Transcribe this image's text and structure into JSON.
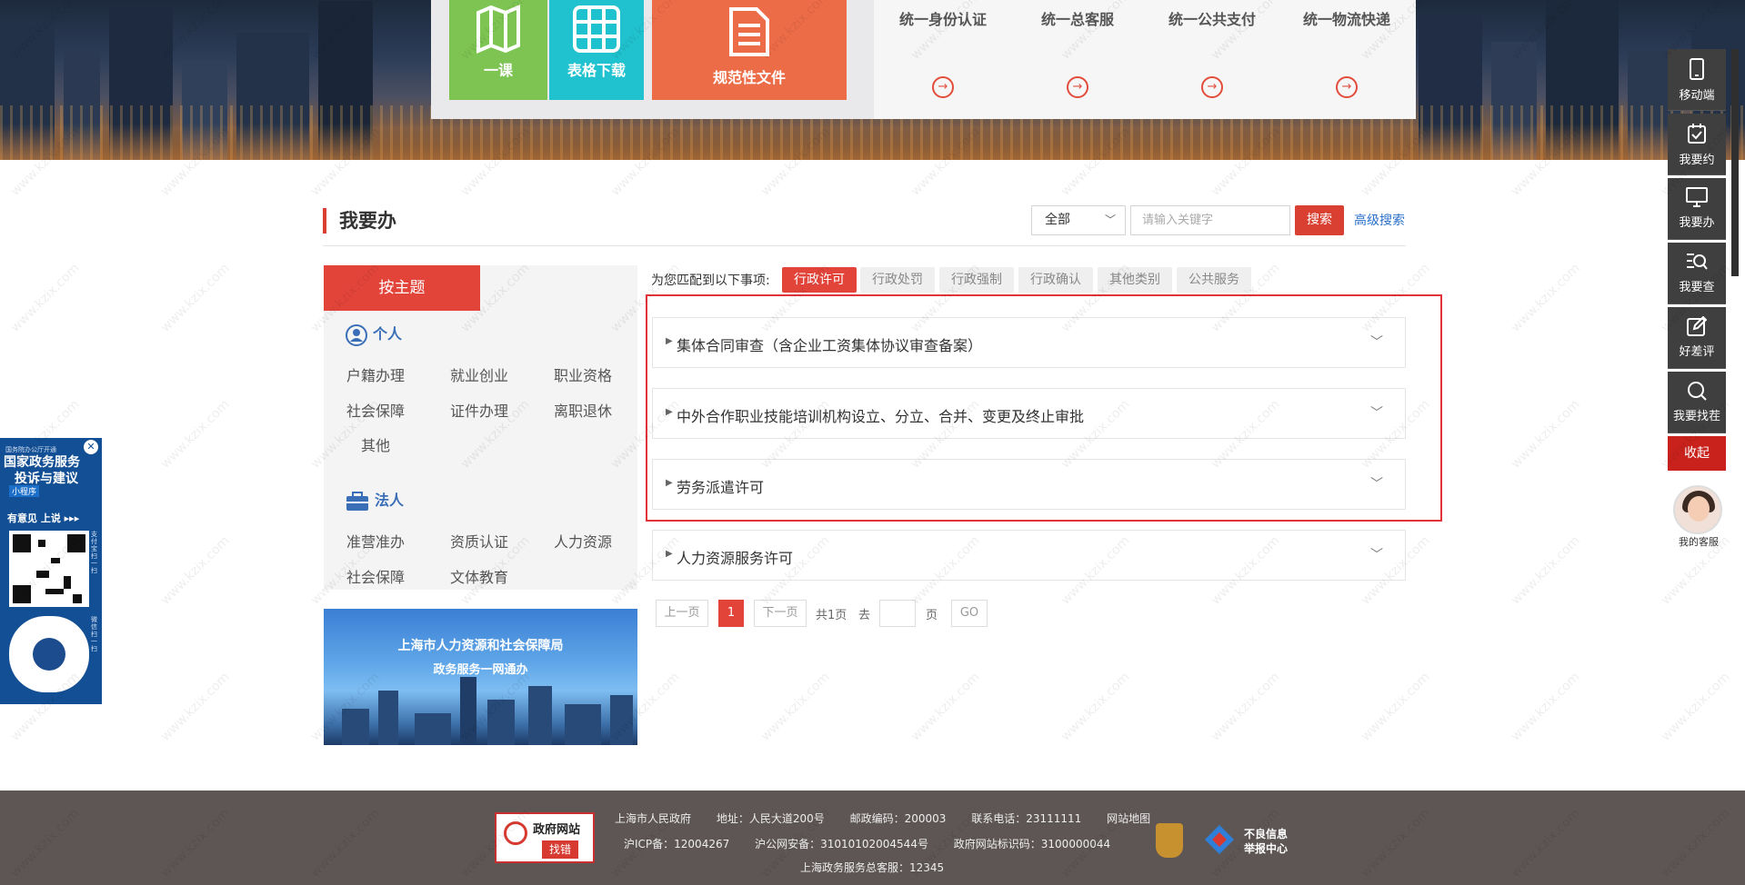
{
  "hero": {
    "tile_green": "一课",
    "tile_cyan": "表格下载",
    "tile_orange": "规范性文件",
    "services": [
      "统一身份认证",
      "统一总客服",
      "统一公共支付",
      "统一物流快递"
    ]
  },
  "section": {
    "title": "我要办",
    "scope_select": "全部",
    "search_placeholder": "请输入关键字",
    "search_button": "搜索",
    "advanced_search": "高级搜索"
  },
  "categories": {
    "tab": "按主题",
    "personal": {
      "label": "个人",
      "items": [
        "户籍办理",
        "就业创业",
        "职业资格",
        "社会保障",
        "证件办理",
        "离职退休",
        "其他"
      ]
    },
    "legal": {
      "label": "法人",
      "items": [
        "准营准办",
        "资质认证",
        "人力资源",
        "社会保障",
        "文体教育"
      ]
    }
  },
  "promo": {
    "line1": "上海市人力资源和社会保障局",
    "line2": "政务服务一网通办"
  },
  "filters": {
    "label": "为您匹配到以下事项:",
    "tabs": [
      "行政许可",
      "行政处罚",
      "行政强制",
      "行政确认",
      "其他类别",
      "公共服务"
    ],
    "active": "行政许可"
  },
  "results": [
    "集体合同审查（含企业工资集体协议审查备案）",
    "中外合作职业技能培训机构设立、分立、合并、变更及终止审批",
    "劳务派遣许可",
    "人力资源服务许可"
  ],
  "pager": {
    "prev": "上一页",
    "current": "1",
    "next": "下一页",
    "total": "共1页",
    "goto_prefix": "去",
    "goto_suffix": "页",
    "go": "GO"
  },
  "footer": {
    "badge_top": "政府网站",
    "badge_bottom": "找错",
    "row1": [
      "上海市人民政府",
      "地址：人民大道200号",
      "邮政编码：200003",
      "联系电话：23111111",
      "网站地图"
    ],
    "icp": "沪ICP备：12004267",
    "police": "沪公网安备：31010102004544号",
    "gov_id": "政府网站标识码：3100000044",
    "hotline": "上海政务服务总客服：12345",
    "report_line1": "不良信息",
    "report_line2": "举报中心"
  },
  "right_bar": {
    "items": [
      "移动端",
      "我要约",
      "我要办",
      "我要查",
      "好差评",
      "我要找茬"
    ],
    "collapse": "收起",
    "service": "我的客服"
  },
  "left_float": {
    "small": "国务院办公厅开通",
    "title1": "国家政务服务",
    "title2": "投诉与建议",
    "tag": "小程序",
    "cta": "有意见 上说 ▸▸▸",
    "side1": "支付宝扫一扫",
    "side2": "微信扫一扫"
  },
  "watermark": "www.kzix.com"
}
